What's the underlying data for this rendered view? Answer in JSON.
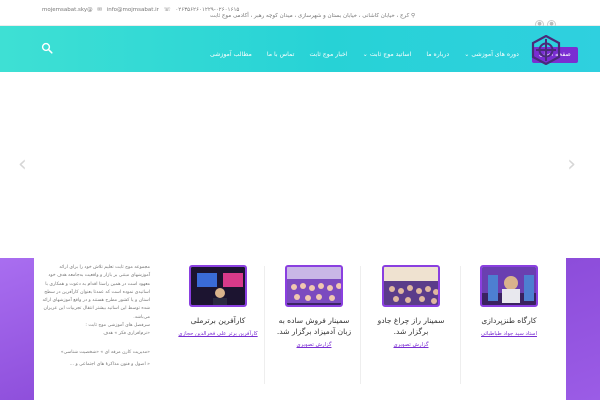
{
  "topbar": {
    "email_1": "mojemsabat.sky@",
    "email_2": "info@mojmsabat.ir",
    "phone": "۰۲۶۳۵۶۲۶۰۱۲۲۹-۰۲۶۰۱۶۱۵",
    "address": "کرج ، خیابان کاشانی ، خیابان بستان و شهرسازی ، میدان کوچه رهبر ، آکادمی موج ثابت"
  },
  "nav": {
    "items": [
      {
        "label": "صفحه اصلی"
      },
      {
        "label": "دوره های آموزشی ⌄"
      },
      {
        "label": "درباره ما"
      },
      {
        "label": "اساتید موج ثابت ⌄"
      },
      {
        "label": "اخبار موج ثابت"
      },
      {
        "label": "تماس با ما"
      },
      {
        "label": "مطالب آموزشی"
      }
    ]
  },
  "slider": {
    "prev": "‹",
    "next": "›"
  },
  "cards": [
    {
      "title": "کارگاه طنزپردازی",
      "link": "استاد سید جواد طباطبائی"
    },
    {
      "title": "سمینار راز چراغ جادو برگزار شد.",
      "link": "گزارش تصویری"
    },
    {
      "title": "سمینار فروش ساده به زبان آدمیزاد برگزار شد.",
      "link": "گزارش تصویری"
    },
    {
      "title": "کارآفرین برترملی",
      "link": "کارآفرین برتر علی فخرالدین حجازی"
    }
  ],
  "about": {
    "text": "مجموعه موج ثابت تعلیم تلاش خود را برای ارائه آموزشهای مبتنی بر بازار و واقعیت به‌جامعه هدف خود معهود است در همین راستا اقدام به دعوت و همکاری با اساتیدی نموده است که عمدتا بعنوان کارآفرین در سطح استان و یا کشور مطرح هستند و در واقع آموزشهای ارائه شده توسط این اساتید بیشتر انتقال تجربیات این عزیزان می‌باشد.",
    "line_1": "سرفصل های آموزشی موج ثابت :",
    "line_2": "«نرم‌افزاری فکر » هدف",
    "line_3": "«مدیریت کارن مرقه ای » «شخصیت شناسی»",
    "line_4": "« اصول و فنون مذاکرهٔ های اجتماعی و ..."
  }
}
